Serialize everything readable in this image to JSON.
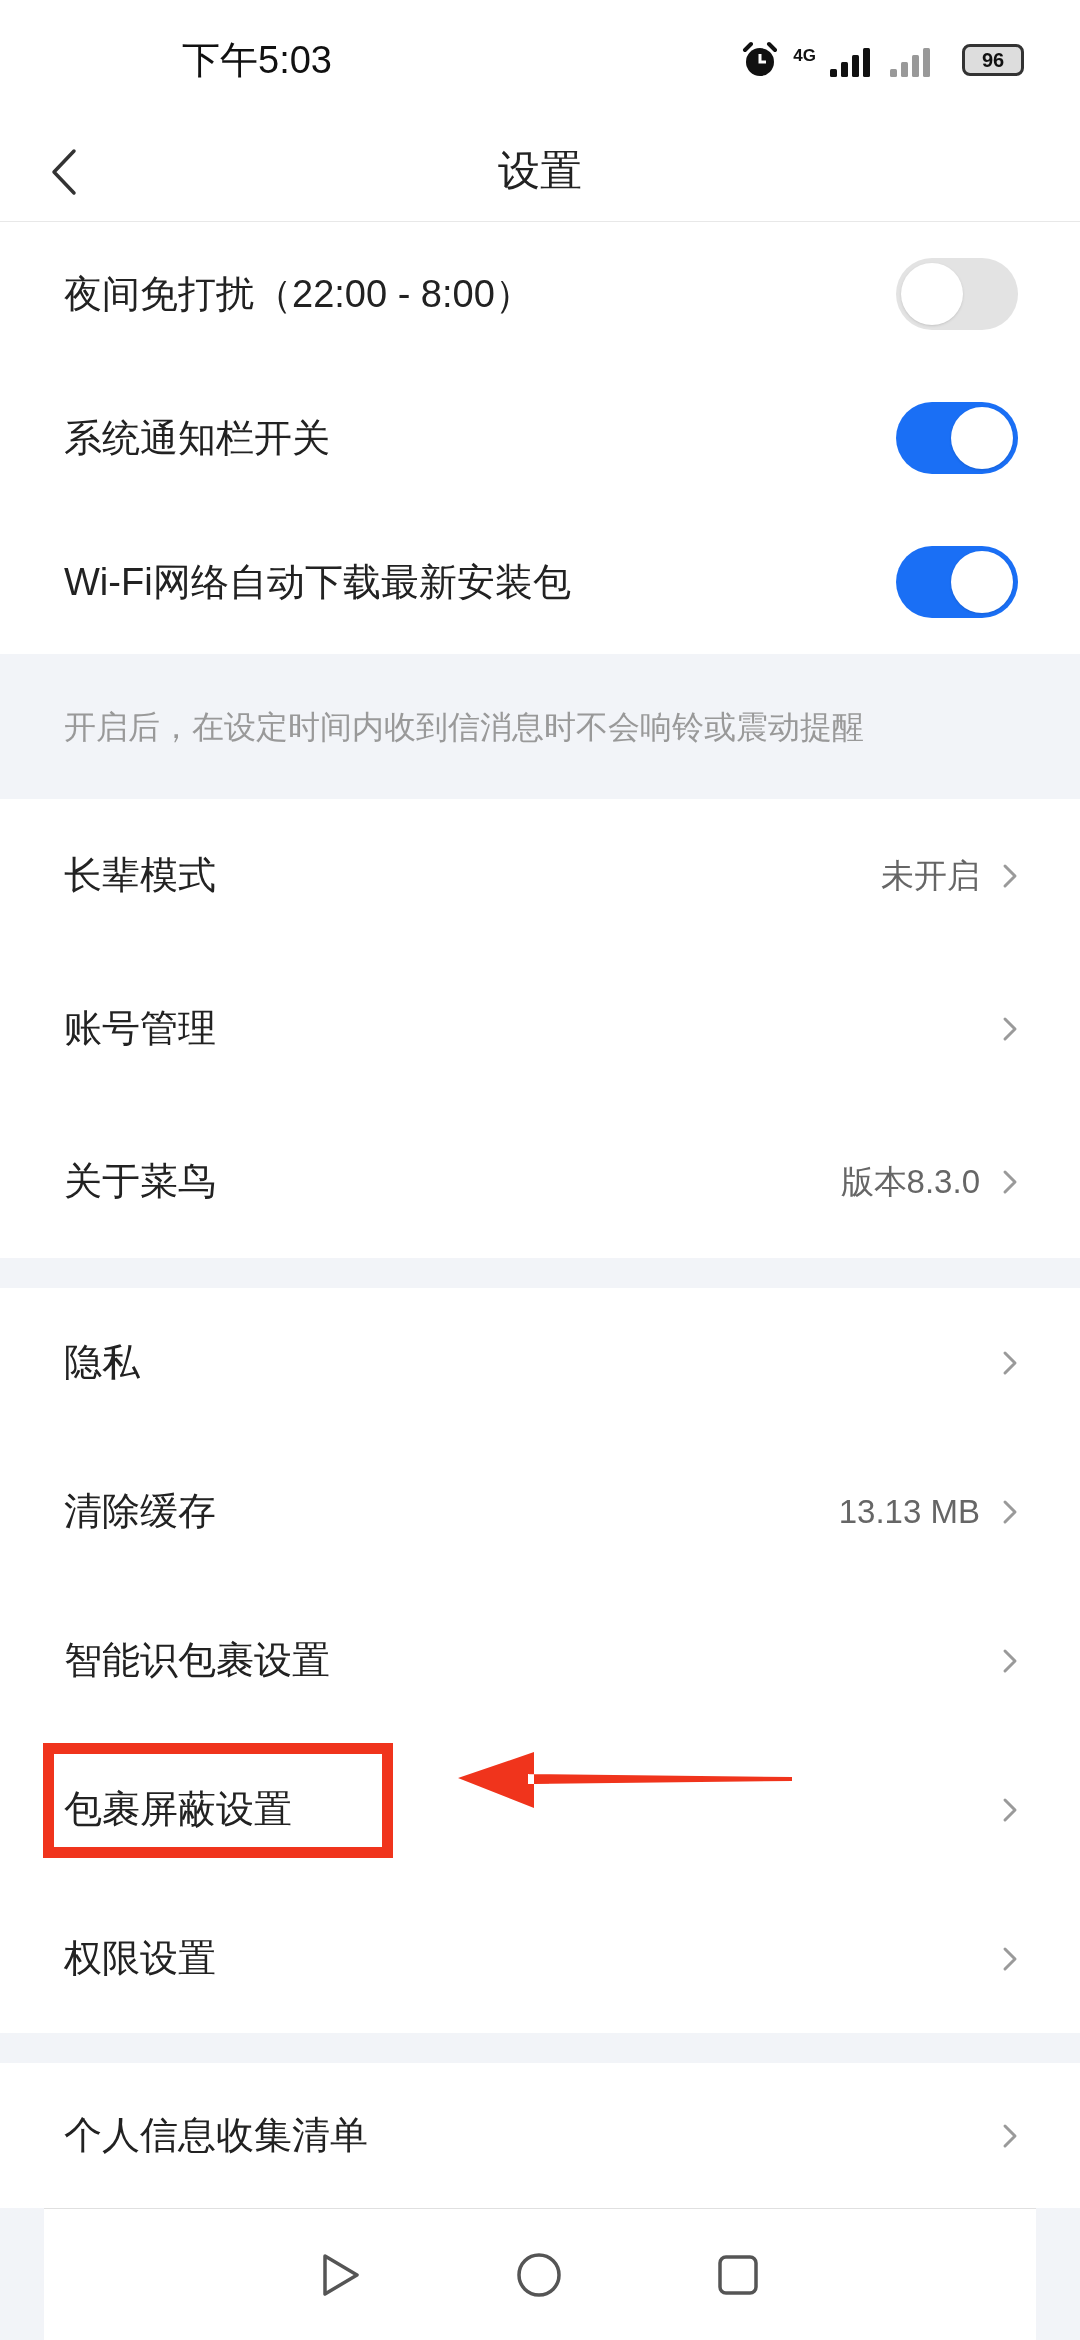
{
  "status_bar": {
    "time": "下午5:03",
    "network": "4G",
    "battery": "96"
  },
  "header": {
    "title": "设置"
  },
  "toggles": [
    {
      "label": "夜间免打扰（22:00 - 8:00）",
      "on": false
    },
    {
      "label": "系统通知栏开关",
      "on": true
    },
    {
      "label": "Wi-Fi网络自动下载最新安装包",
      "on": true
    }
  ],
  "note": "开启后，在设定时间内收到信消息时不会响铃或震动提醒",
  "sections": [
    [
      {
        "label": "长辈模式",
        "value": "未开启"
      },
      {
        "label": "账号管理"
      },
      {
        "label": "关于菜鸟",
        "value": "版本8.3.0"
      }
    ],
    [
      {
        "label": "隐私"
      },
      {
        "label": "清除缓存",
        "value": "13.13 MB"
      },
      {
        "label": "智能识包裹设置"
      },
      {
        "label": "包裹屏蔽设置"
      },
      {
        "label": "权限设置"
      }
    ],
    [
      {
        "label": "个人信息收集清单"
      }
    ]
  ]
}
